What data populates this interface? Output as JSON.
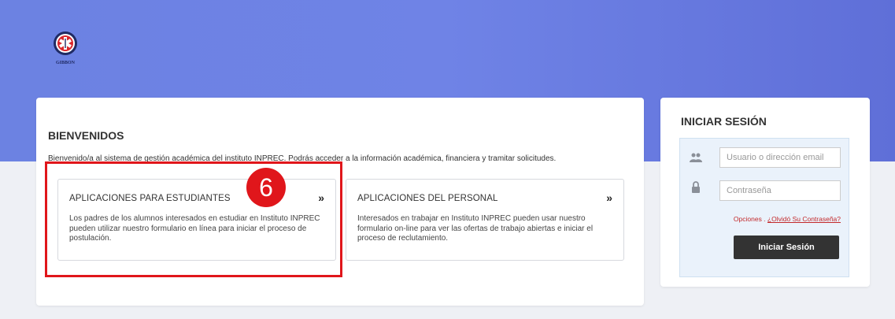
{
  "logo": {
    "text": "GIBBON",
    "icon": "medical-star-logo"
  },
  "welcome": {
    "title": "BIENVENIDOS",
    "description": "Bienvenido/a al sistema de gestión académica del instituto INPREC. Podrás acceder a la información académica, financiera y tramitar solicitudes.",
    "apps": [
      {
        "title": "APLICACIONES PARA ESTUDIANTES",
        "arrow": "»",
        "description": "Los padres de los alumnos interesados en estudiar en Instituto INPREC pueden utilizar nuestro formulario en línea para iniciar el proceso de postulación."
      },
      {
        "title": "APLICACIONES DEL PERSONAL",
        "arrow": "»",
        "description": "Interesados en trabajar en Instituto INPREC pueden usar nuestro formulario on-line para ver las ofertas de trabajo abiertas e iniciar el proceso de reclutamiento."
      }
    ]
  },
  "annotation": {
    "step": "6",
    "color": "#e0161b"
  },
  "login": {
    "title": "INICIAR SESIÓN",
    "username_placeholder": "Usuario o dirección email",
    "password_placeholder": "Contraseña",
    "options_label": "Opciones .",
    "forgot_link": "¿Olvidó Su Contraseña?",
    "submit_label": "Iniciar Sesión",
    "username_icon": "users-icon",
    "password_icon": "lock-icon"
  }
}
